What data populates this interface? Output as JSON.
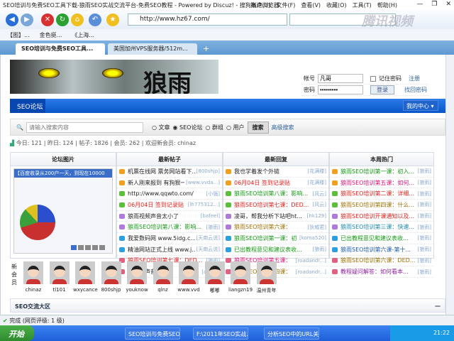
{
  "window": {
    "title": "SEO培训与免费SEO工具下载-狼雨SEO实战交流平台-免费SEO教程 - Powered by Discuz! - 搜狗高速浏览器",
    "menus": [
      "账户(U)",
      "文件(F)",
      "查看(V)",
      "收藏(O)",
      "工具(T)",
      "帮助(H)"
    ],
    "controls": [
      "—",
      "❐",
      "✕"
    ]
  },
  "toolbar": {
    "url": "http://www.hz67.com/",
    "watermark": "腾讯视频"
  },
  "favorites": [
    "【图】...",
    "金色挺...",
    "《上海..."
  ],
  "tabs": [
    "SEO培训与免费SEO工具...",
    "美国加州VPS服务器/512m..."
  ],
  "header": {
    "logo_text": "狼雨",
    "account_label": "帐号",
    "account_value": "凡哥",
    "password_label": "密码",
    "password_value": "•••••••••",
    "remember": "记住密码",
    "register": "注册",
    "login": "登录",
    "forgot": "找回密码"
  },
  "nav": {
    "label": "SEO论坛",
    "my_center": "我的中心"
  },
  "search": {
    "placeholder": "请输入搜索内容",
    "options": [
      "文章",
      "SEO论坛",
      "群组",
      "用户"
    ],
    "selected": "SEO论坛",
    "button": "搜索",
    "advanced": "高级搜索"
  },
  "stats": "今日: 121 | 昨日: 124 | 帖子: 1826 | 会员: 262 | 欢迎新会员: chinaz",
  "columns": {
    "pictures": {
      "title": "论坛图片",
      "caption": "【百度收录从200户一天，到现在10000"
    },
    "latest": {
      "title": "最新帖子",
      "items": [
        {
          "t": "机票在线网 票务网站看下...",
          "a": "[800shjp]",
          "c": "#222"
        },
        {
          "t": "新人刚来报到 有狗狠一",
          "a": "[www.vvda...]",
          "c": "#222"
        },
        {
          "t": "http://www.qqwto.com/",
          "a": "[小强]",
          "c": "#222"
        },
        {
          "t": "06月04日 签到记录贴",
          "a": "[lh775312...]",
          "c": "#e0201c"
        },
        {
          "t": "狼雨视频声音太小了",
          "a": "[bafeel]",
          "c": "#222"
        },
        {
          "t": "狼雨SEO培训第八课：影响...",
          "a": "[狼雨]",
          "c": "#129a12"
        },
        {
          "t": "我爱数码网 www.5idg.c...",
          "a": "[天南云说]",
          "c": "#222"
        },
        {
          "t": "精油网站正式上线 www.j...",
          "a": "[天南云说]",
          "c": "#222"
        },
        {
          "t": "狼雨SEO培训第七课：DED...",
          "a": "[狼雨]",
          "c": "#e0201c"
        },
        {
          "t": "头痛有声音说图像",
          "a": "[orfool]",
          "c": "#222"
        }
      ]
    },
    "replies": {
      "title": "最新回复",
      "items": [
        {
          "t": "我也学着发个外链",
          "a": "[花满楼]",
          "c": "#222"
        },
        {
          "t": "06月04日 签到记录贴",
          "a": "[花满楼]",
          "c": "#e0201c"
        },
        {
          "t": "狼雨SEO培训第八课：影响...",
          "a": "[风云]",
          "c": "#129a12"
        },
        {
          "t": "狼雨SEO培训第七课：DED...",
          "a": "[风云]",
          "c": "#e0201c"
        },
        {
          "t": "凌哥，帮我分析下站吧ht...",
          "a": "[hk129]",
          "c": "#222"
        },
        {
          "t": "狼雨SEO培训第六课：",
          "a": "[狄威君]",
          "c": "#a07000"
        },
        {
          "t": "狼雨SEO培训第一课：初",
          "a": "[koma520]",
          "c": "#129a12"
        },
        {
          "t": "已出教程意见和建议表收...",
          "a": "[狼雨]",
          "c": "#129a12"
        },
        {
          "t": "狼雨SEO培训第五课：",
          "a": "[roadandr...]",
          "c": "#e0107a"
        },
        {
          "t": "狼雨SEO培训第四课：",
          "a": "[roadandr...]",
          "c": "#a07000"
        }
      ]
    },
    "hot": {
      "title": "本周热门",
      "items": [
        {
          "t": "狼雨SEO培训第一课：初入...",
          "a": "[狼雨]",
          "c": "#129a12"
        },
        {
          "t": "狼雨SEO培训第五课：如何...",
          "a": "[狼雨]",
          "c": "#e0107a"
        },
        {
          "t": "狼雨SEO培训第二课：详细...",
          "a": "[狼雨]",
          "c": "#e0201c"
        },
        {
          "t": "狼雨SEO培训第四课：什么...",
          "a": "[狼雨]",
          "c": "#a07000"
        },
        {
          "t": "狼雨SEO培训开课通知以及...",
          "a": "[狼雨]",
          "c": "#e0201c"
        },
        {
          "t": "狼雨SEO培训第三课：快速...",
          "a": "[狼雨]",
          "c": "#1a8ab0"
        },
        {
          "t": "已出教程意见和建议表收...",
          "a": "[狼雨]",
          "c": "#129a12"
        },
        {
          "t": "狼雨SEO培训第六课-第十...",
          "a": "[狼雨]",
          "c": "#1a5ab0"
        },
        {
          "t": "狼雨SEO培训第六课：DED...",
          "a": "[狼雨]",
          "c": "#a07000"
        },
        {
          "t": "教程疑问解答：如何看本...",
          "a": "[狼雨]",
          "c": "#9020a0"
        }
      ]
    }
  },
  "icon_colors": [
    "#f0a020",
    "#f0a020",
    "#5cbf3c",
    "#5cbf3c",
    "#b07ad8",
    "#b07ad8",
    "#2aa0e0",
    "#2aa0e0",
    "#e06080",
    "#e06080"
  ],
  "members": {
    "label": "新会员",
    "names": [
      "chinaz",
      "tl101",
      "wxycance",
      "800shjp",
      "youknow",
      "qlnz",
      "www.vvd",
      "嘟嘟",
      "liangzn19",
      "温州青年"
    ]
  },
  "zone": {
    "title": "SEO交流大区",
    "toggle": "—"
  },
  "status": "完成 (网页评级: 1 级)",
  "taskbar": {
    "start": "开始",
    "tasks": [
      "SEO培训与免费SEO",
      "F:\\2011年SEO实战...",
      "分析SEO中的URL关..."
    ],
    "clock": "21:22"
  }
}
